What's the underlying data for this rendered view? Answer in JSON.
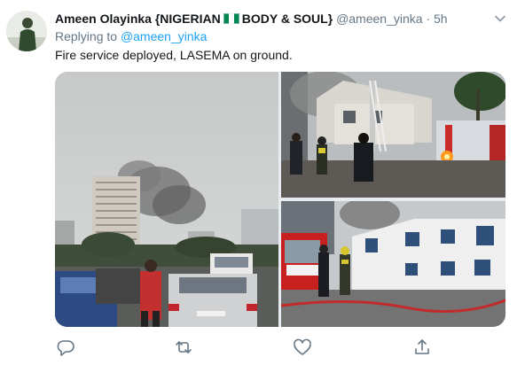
{
  "tweet": {
    "display_name": "Ameen Olayinka {NIGERIAN",
    "display_name_suffix": "BODY & SOUL}",
    "handle": "@ameen_yinka",
    "separator": "·",
    "time": "5h",
    "replying_prefix": "Replying to",
    "replying_to": "@ameen_yinka",
    "text": "Fire service deployed, LASEMA on ground."
  },
  "icons": {
    "more": "chevron-down-icon",
    "flag": "nigeria-flag-icon",
    "reply": "reply-icon",
    "retweet": "retweet-icon",
    "like": "heart-icon",
    "share": "share-icon"
  },
  "colors": {
    "link": "#1da1f2",
    "secondary_text": "#657786",
    "flag_green": "#008751"
  }
}
